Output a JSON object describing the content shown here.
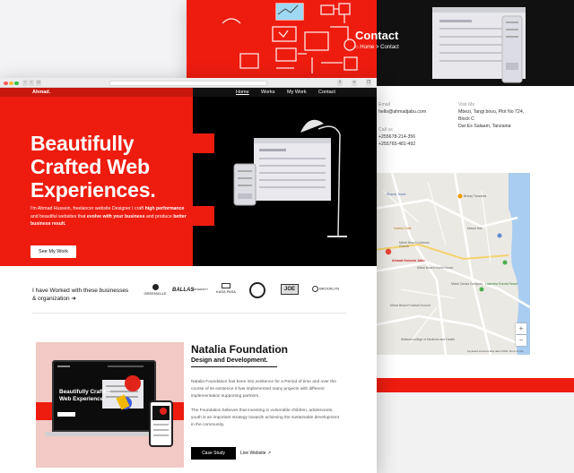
{
  "contact_page": {
    "title": "Contact",
    "breadcrumb": "Home > Contact",
    "email_label": "Email",
    "email_value": "hello@ahmadjabu.com",
    "call_label": "Call us",
    "phones": [
      "+255678-214-356",
      "+255765-481-492"
    ],
    "visit_label": "Visit Me",
    "address_lines": [
      "Mbezi, Tangi bovu, Plot No 724,",
      "Block C",
      "Dar Es Salaam, Tanzania"
    ],
    "map": {
      "labels": [
        "Shams Tower",
        "Bnkay Tanzania",
        "Maoni Hall",
        "Lemon Cafe",
        "Mbezi Beach Lutheran Church",
        "Ahmad Hussein Jabu",
        "Lakeview Events Resort",
        "Mbezi Zaniza Dumpukt",
        "Mbezi Beach Guest House",
        "Bolt Ads Office",
        "Lagos Seyes",
        "Mtaa Sim Dodoma",
        "Mbezi Beach Football Ground",
        "Sea Cliff Hotel",
        "Kandela",
        "Leopards Mini Mall",
        "Williams college of Medicine and Health",
        "Mambo Academy"
      ],
      "zoom_in": "+",
      "zoom_out": "−",
      "footer": "Keyboard shortcuts   Map data ©2021   Terms of Use"
    }
  },
  "browser": {
    "nav_brand": "Ahmad.",
    "nav_items": [
      "Home",
      "Works",
      "My Work",
      "Contact"
    ]
  },
  "hero": {
    "headline": "Beautifully Crafted Web Experiences.",
    "intro_parts": [
      "I'm Ahmad Hussein, freelancer website Designer I craft ",
      "high performance",
      " and beautiful websites that ",
      "evolve with your business",
      " and produce ",
      "better business result."
    ],
    "cta": "See My Work"
  },
  "clients": {
    "title": "I have Worked with these businesses & organization ➜",
    "logos": [
      "GREENVILLE",
      "BALLAS",
      "UNIVERSITY",
      "KASA PASA",
      "PERSONAL SEAL",
      "JOE",
      "BROOKLYN"
    ]
  },
  "project": {
    "title": "Natalia Foundation",
    "subtitle": "Design and Development.",
    "laptop_headline": "Beautifully Crafted Web Experience.",
    "para1": "Natalia Foundation has been into existence for a Period of time and over the course of its existence it has implemented many projects with different implementation supporting partners.",
    "para2": "The Foundation believes that investing in vulnerable children, adolescents, youth is an important strategy towards achieving the sustainable development in the community.",
    "case_study": "Case Study",
    "live_site": "Live Website"
  },
  "colors": {
    "accent_red": "#ee1c0f",
    "dark": "#000000",
    "map_bg": "#e9e7e1",
    "water": "#a9cdf0"
  }
}
